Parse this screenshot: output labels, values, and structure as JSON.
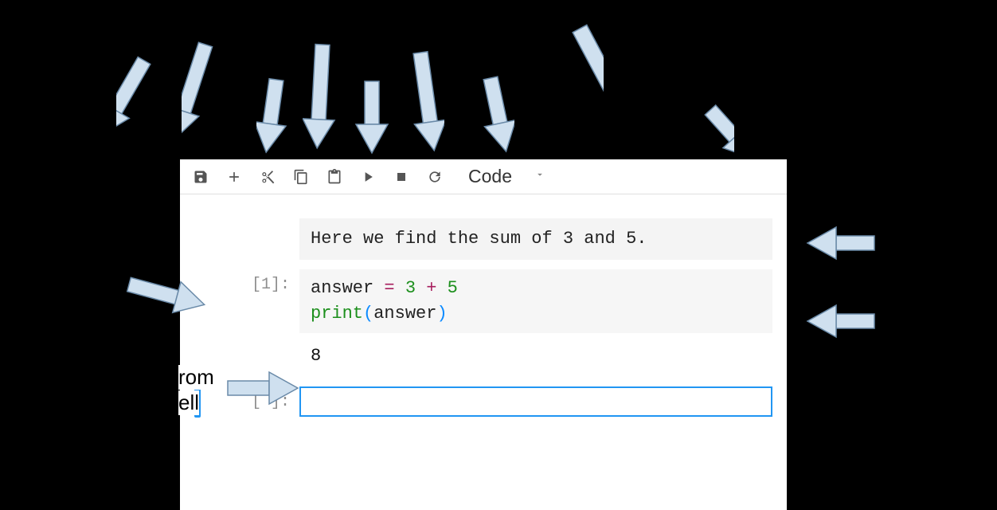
{
  "toolbar": {
    "save_title": "Save",
    "add_title": "Insert cell below",
    "cut_title": "Cut cell",
    "copy_title": "Copy cell",
    "paste_title": "Paste cell",
    "run_title": "Run cell",
    "stop_title": "Interrupt kernel",
    "restart_title": "Restart kernel",
    "cell_type_label": "Code"
  },
  "cells": {
    "markdown_text": "Here we find the sum of 3 and 5.",
    "code1_prompt": "[1]:",
    "code1_line1_var": "answer",
    "code1_line1_eq": " = ",
    "code1_line1_n1": "3",
    "code1_line1_plus": " + ",
    "code1_line1_n2": "5",
    "code1_line2_func": "print",
    "code1_line2_open": "(",
    "code1_line2_arg": "answer",
    "code1_line2_close": ")",
    "output1": "8",
    "empty_prompt": "[ ]:"
  },
  "side_labels": {
    "partial_top": "rom",
    "partial_bottom": "ell"
  },
  "arrow_color": "#cfe0ef",
  "arrow_stroke": "#6a8aa8"
}
